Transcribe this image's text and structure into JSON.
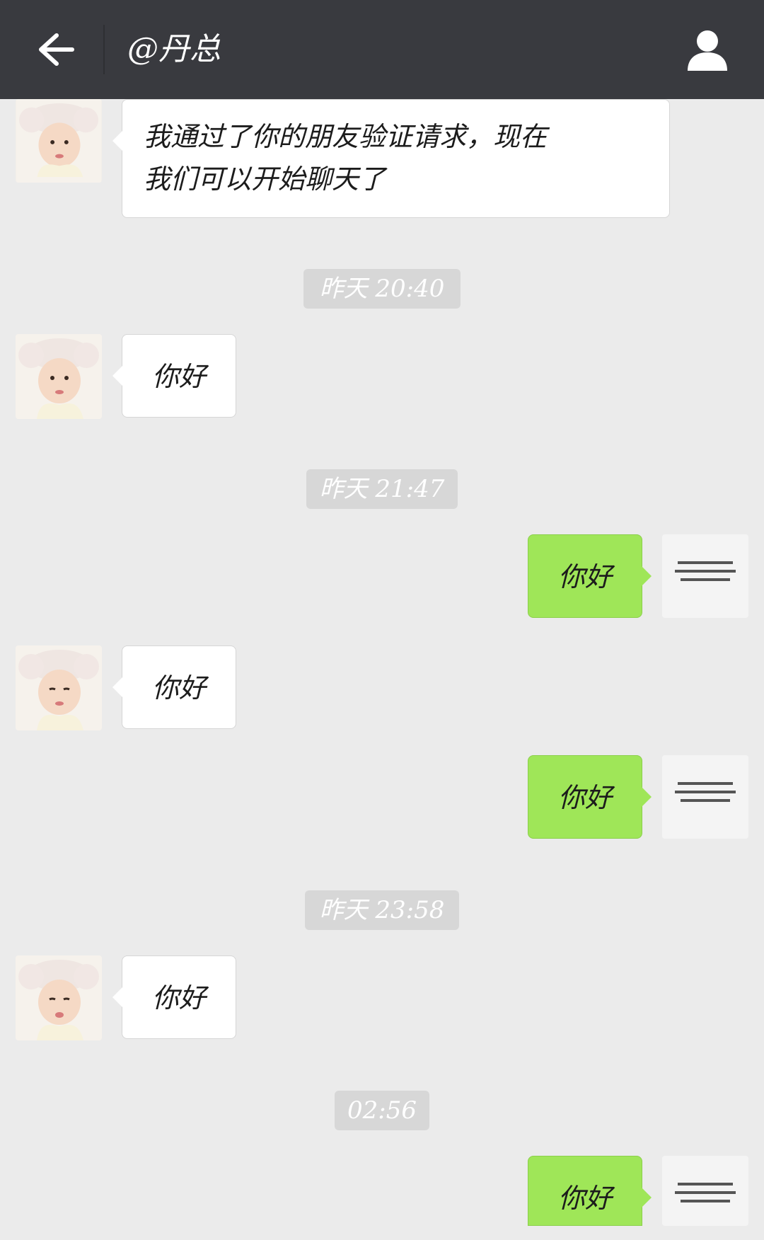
{
  "header": {
    "title": "@丹总",
    "back_icon": "arrow-left-icon",
    "profile_icon": "person-icon"
  },
  "colors": {
    "header_bg": "#393a3f",
    "chat_bg": "#ebebeb",
    "outgoing_bubble": "#9fe658",
    "incoming_bubble": "#ffffff",
    "timestamp_bg": "#d7d7d7"
  },
  "messages": {
    "m1": {
      "direction": "incoming",
      "line1": "我通过了你的朋友验证请求，现在",
      "line2": "我们可以开始聊天了"
    },
    "t1": "昨天 20:40",
    "m2": {
      "direction": "incoming",
      "text": "你好"
    },
    "t2": "昨天 21:47",
    "m3": {
      "direction": "outgoing",
      "text": "你好"
    },
    "m4": {
      "direction": "incoming",
      "text": "你好"
    },
    "m5": {
      "direction": "outgoing",
      "text": "你好"
    },
    "t3": "昨天 23:58",
    "m6": {
      "direction": "incoming",
      "text": "你好"
    },
    "t4": "02:56",
    "m7": {
      "direction": "outgoing",
      "text": "你好"
    }
  }
}
